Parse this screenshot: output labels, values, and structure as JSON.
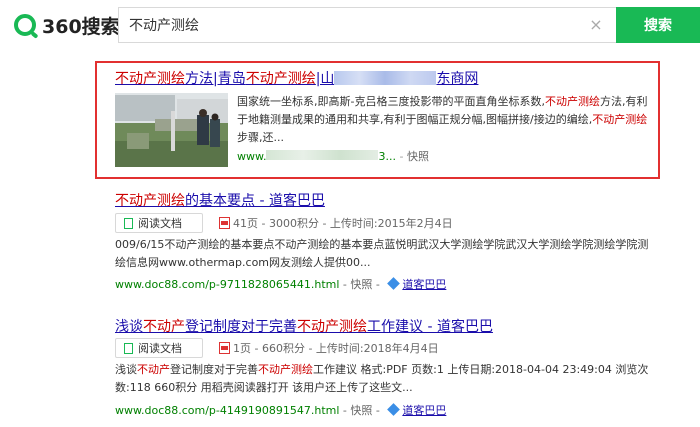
{
  "header": {
    "logo_text": "360搜索",
    "query": "不动产测绘",
    "clear_icon": "×",
    "search_button": "搜索"
  },
  "results": [
    {
      "title_parts": [
        "不动产测绘",
        "方法|青岛",
        "不动产测绘",
        "|山",
        "东商网"
      ],
      "snippet_parts": [
        "国家统一坐标系,即高斯-克吕格三度投影带的平面直角坐标系数,",
        "不动产测绘",
        "方法,有利于地籍测量成果的通用和共享,有利于图幅正规分幅,图幅拼接/接边的编绘,",
        "不动产测绘",
        "步骤,还..."
      ],
      "url": "www.",
      "url_tail": "3...",
      "snapshot": "快照"
    },
    {
      "title_parts": [
        "不动产测绘",
        "的基本要点 - 道客巴巴"
      ],
      "read_label": "阅读文档",
      "meta": "41页 - 3000积分 - 上传时间:2015年2月4日",
      "desc": "009/6/15不动产测绘的基本要点不动产测绘的基本要点蓝悦明武汉大学测绘学院武汉大学测绘学院测绘学院测绘信息网www.othermap.com网友测绘人提供00...",
      "url": "www.doc88.com/p-9711828065441.html",
      "snapshot": "快照",
      "site": "道客巴巴"
    },
    {
      "title_parts": [
        "浅谈",
        "不动产",
        "登记制度对于完善",
        "不动产测绘",
        "工作建议 - 道客巴巴"
      ],
      "read_label": "阅读文档",
      "meta": "1页 - 660积分 - 上传时间:2018年4月4日",
      "desc_parts": [
        "浅谈",
        "不动产",
        "登记制度对于完善",
        "不动产测绘",
        "工作建议 格式:PDF 页数:1 上传日期:2018-04-04 23:49:04 浏览次数:118 660积分 用稻壳阅读器打开 该用户还上传了这些文..."
      ],
      "url": "www.doc88.com/p-4149190891547.html",
      "snapshot": "快照",
      "site": "道客巴巴"
    }
  ],
  "colors": {
    "brand": "#19b955",
    "link": "#1a0dab",
    "highlight": "#cc0000",
    "url": "#008000",
    "callout_border": "#e23030"
  },
  "icons": [
    "logo-360-icon",
    "clear-icon",
    "doc-icon",
    "pdf-icon",
    "site-diamond-icon"
  ]
}
